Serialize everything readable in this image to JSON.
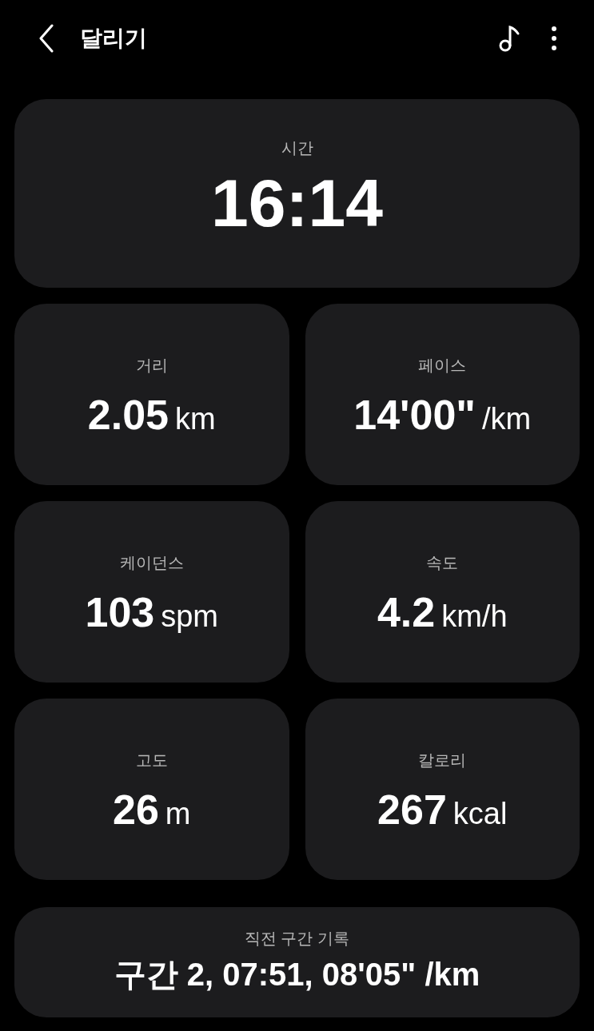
{
  "header": {
    "title": "달리기"
  },
  "time": {
    "label": "시간",
    "value": "16:14"
  },
  "metrics": [
    {
      "label": "거리",
      "value": "2.05",
      "unit": "km"
    },
    {
      "label": "페이스",
      "value": "14'00\"",
      "unit": "/km"
    },
    {
      "label": "케이던스",
      "value": "103",
      "unit": "spm"
    },
    {
      "label": "속도",
      "value": "4.2",
      "unit": "km/h"
    },
    {
      "label": "고도",
      "value": "26",
      "unit": "m"
    },
    {
      "label": "칼로리",
      "value": "267",
      "unit": "kcal"
    }
  ],
  "last_split": {
    "label": "직전 구간 기록",
    "value": "구간 2, 07:51, 08'05\" /km"
  }
}
